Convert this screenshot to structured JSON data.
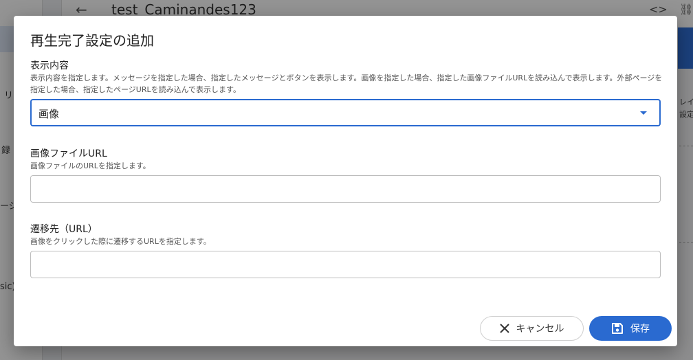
{
  "background": {
    "page_title": "test_Caminandes123",
    "side_labels": [
      "リ",
      "録",
      "ージ",
      "sic)"
    ],
    "right_labels": [
      "レイ",
      "設定を"
    ]
  },
  "dialog": {
    "title": "再生完了設定の追加",
    "display_content": {
      "label": "表示内容",
      "help": "表示内容を指定します。メッセージを指定した場合、指定したメッセージとボタンを表示します。画像を指定した場合、指定した画像ファイルURLを読み込んで表示します。外部ページを指定した場合、指定したページURLを読み込んで表示します。",
      "selected": "画像"
    },
    "image_url": {
      "label": "画像ファイルURL",
      "help": "画像ファイルのURLを指定します。",
      "value": "",
      "placeholder": ""
    },
    "link_url": {
      "label": "遷移先（URL）",
      "help": "画像をクリックした際に遷移するURLを指定します。",
      "value": "",
      "placeholder": ""
    },
    "buttons": {
      "cancel": "キャンセル",
      "save": "保存"
    }
  },
  "colors": {
    "primary": "#2a6ad0",
    "scrim": "rgba(0,0,0,0.42)"
  }
}
